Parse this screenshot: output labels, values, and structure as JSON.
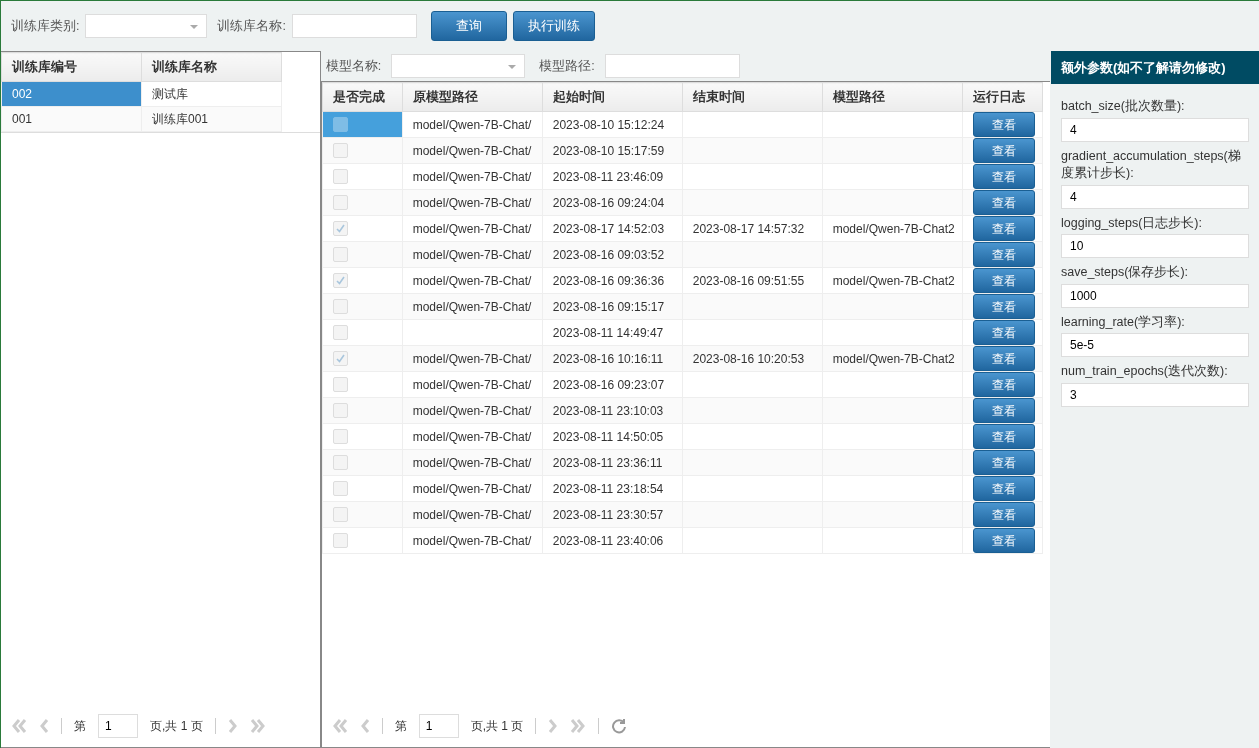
{
  "toolbar": {
    "category_label": "训练库类别:",
    "name_label": "训练库名称:",
    "buttons": [
      "查询",
      "执行训练"
    ]
  },
  "library_table": {
    "columns": [
      "训练库编号",
      "训练库名称"
    ],
    "rows": [
      {
        "cells": [
          "002",
          "测试库"
        ],
        "selected": true
      },
      {
        "cells": [
          "001",
          "训练库001"
        ],
        "selected": false
      }
    ],
    "pager": {
      "page_label": "第",
      "page": "1",
      "total": "页,共 1 页"
    }
  },
  "model_filter": {
    "name_label": "模型名称:",
    "path_label": "模型路径:"
  },
  "model_table": {
    "columns": [
      "是否完成",
      "原模型路径",
      "起始时间",
      "结束时间",
      "模型路径",
      "运行日志"
    ],
    "rows": [
      {
        "checked": false,
        "selected": true,
        "source": "model/Qwen-7B-Chat/",
        "start": "2023-08-10 15:12:24",
        "end": "",
        "path": "",
        "log": "查看"
      },
      {
        "checked": false,
        "selected": false,
        "source": "model/Qwen-7B-Chat/",
        "start": "2023-08-10 15:17:59",
        "end": "",
        "path": "",
        "log": "查看"
      },
      {
        "checked": false,
        "selected": false,
        "source": "model/Qwen-7B-Chat/",
        "start": "2023-08-11 23:46:09",
        "end": "",
        "path": "",
        "log": "查看"
      },
      {
        "checked": false,
        "selected": false,
        "source": "model/Qwen-7B-Chat/",
        "start": "2023-08-16 09:24:04",
        "end": "",
        "path": "",
        "log": "查看"
      },
      {
        "checked": true,
        "selected": false,
        "source": "model/Qwen-7B-Chat/",
        "start": "2023-08-17 14:52:03",
        "end": "2023-08-17 14:57:32",
        "path": "model/Qwen-7B-Chat2",
        "log": "查看"
      },
      {
        "checked": false,
        "selected": false,
        "source": "model/Qwen-7B-Chat/",
        "start": "2023-08-16 09:03:52",
        "end": "",
        "path": "",
        "log": "查看"
      },
      {
        "checked": true,
        "selected": false,
        "source": "model/Qwen-7B-Chat/",
        "start": "2023-08-16 09:36:36",
        "end": "2023-08-16 09:51:55",
        "path": "model/Qwen-7B-Chat2",
        "log": "查看"
      },
      {
        "checked": false,
        "selected": false,
        "source": "model/Qwen-7B-Chat/",
        "start": "2023-08-16 09:15:17",
        "end": "",
        "path": "",
        "log": "查看"
      },
      {
        "checked": false,
        "selected": false,
        "source": "",
        "start": "2023-08-11 14:49:47",
        "end": "",
        "path": "",
        "log": "查看"
      },
      {
        "checked": true,
        "selected": false,
        "source": "model/Qwen-7B-Chat/",
        "start": "2023-08-16 10:16:11",
        "end": "2023-08-16 10:20:53",
        "path": "model/Qwen-7B-Chat2",
        "log": "查看"
      },
      {
        "checked": false,
        "selected": false,
        "source": "model/Qwen-7B-Chat/",
        "start": "2023-08-16 09:23:07",
        "end": "",
        "path": "",
        "log": "查看"
      },
      {
        "checked": false,
        "selected": false,
        "source": "model/Qwen-7B-Chat/",
        "start": "2023-08-11 23:10:03",
        "end": "",
        "path": "",
        "log": "查看"
      },
      {
        "checked": false,
        "selected": false,
        "source": "model/Qwen-7B-Chat/",
        "start": "2023-08-11 14:50:05",
        "end": "",
        "path": "",
        "log": "查看"
      },
      {
        "checked": false,
        "selected": false,
        "source": "model/Qwen-7B-Chat/",
        "start": "2023-08-11 23:36:11",
        "end": "",
        "path": "",
        "log": "查看"
      },
      {
        "checked": false,
        "selected": false,
        "source": "model/Qwen-7B-Chat/",
        "start": "2023-08-11 23:18:54",
        "end": "",
        "path": "",
        "log": "查看"
      },
      {
        "checked": false,
        "selected": false,
        "source": "model/Qwen-7B-Chat/",
        "start": "2023-08-11 23:30:57",
        "end": "",
        "path": "",
        "log": "查看"
      },
      {
        "checked": false,
        "selected": false,
        "source": "model/Qwen-7B-Chat/",
        "start": "2023-08-11 23:40:06",
        "end": "",
        "path": "",
        "log": "查看"
      }
    ],
    "pager": {
      "page_label": "第",
      "page": "1",
      "total": "页,共 1 页"
    }
  },
  "params": {
    "title": "额外参数(如不了解请勿修改)",
    "fields": [
      {
        "label": "batch_size(批次数量):",
        "value": "4"
      },
      {
        "label": "gradient_accumulation_steps(梯度累计步长):",
        "value": "4"
      },
      {
        "label": "logging_steps(日志步长):",
        "value": "10"
      },
      {
        "label": "save_steps(保存步长):",
        "value": "1000"
      },
      {
        "label": "learning_rate(学习率):",
        "value": "5e-5"
      },
      {
        "label": "num_train_epochs(迭代次数):",
        "value": "3"
      }
    ]
  }
}
